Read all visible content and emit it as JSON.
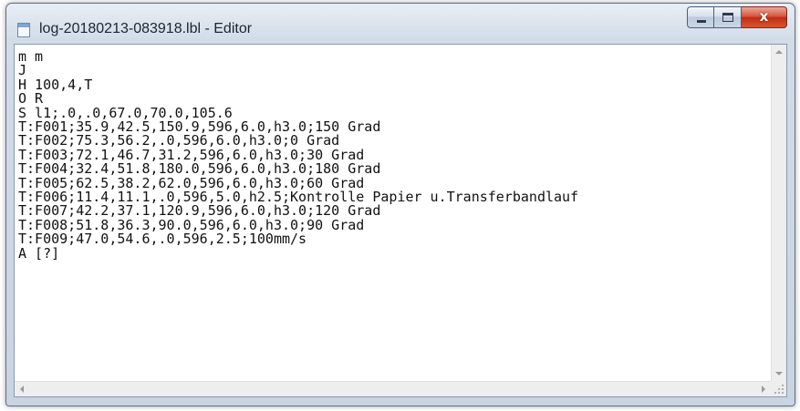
{
  "window": {
    "title": "log-20180213-083918.lbl - Editor",
    "icon": "notepad-icon",
    "buttons": {
      "minimize": "minimize-icon",
      "maximize": "maximize-icon",
      "close_glyph": "x"
    }
  },
  "editor": {
    "content": "m m\nJ\nH 100,4,T\nO R\nS l1;.0,.0,67.0,70.0,105.6\nT:F001;35.9,42.5,150.9,596,6.0,h3.0;150 Grad\nT:F002;75.3,56.2,.0,596,6.0,h3.0;0 Grad\nT:F003;72.1,46.7,31.2,596,6.0,h3.0;30 Grad\nT:F004;32.4,51.8,180.0,596,6.0,h3.0;180 Grad\nT:F005;62.5,38.2,62.0,596,6.0,h3.0;60 Grad\nT:F006;11.4,11.1,.0,596,5.0,h2.5;Kontrolle Papier u.Transferbandlauf\nT:F007;42.2,37.1,120.9,596,6.0,h3.0;120 Grad\nT:F008;51.8,36.3,90.0,596,6.0,h3.0;90 Grad\nT:F009;47.0,54.6,.0,596,2.5;100mm/s\nA [?]"
  },
  "colors": {
    "close_button": "#c8391f",
    "frame": "#c9d4e1",
    "text": "#111111"
  }
}
